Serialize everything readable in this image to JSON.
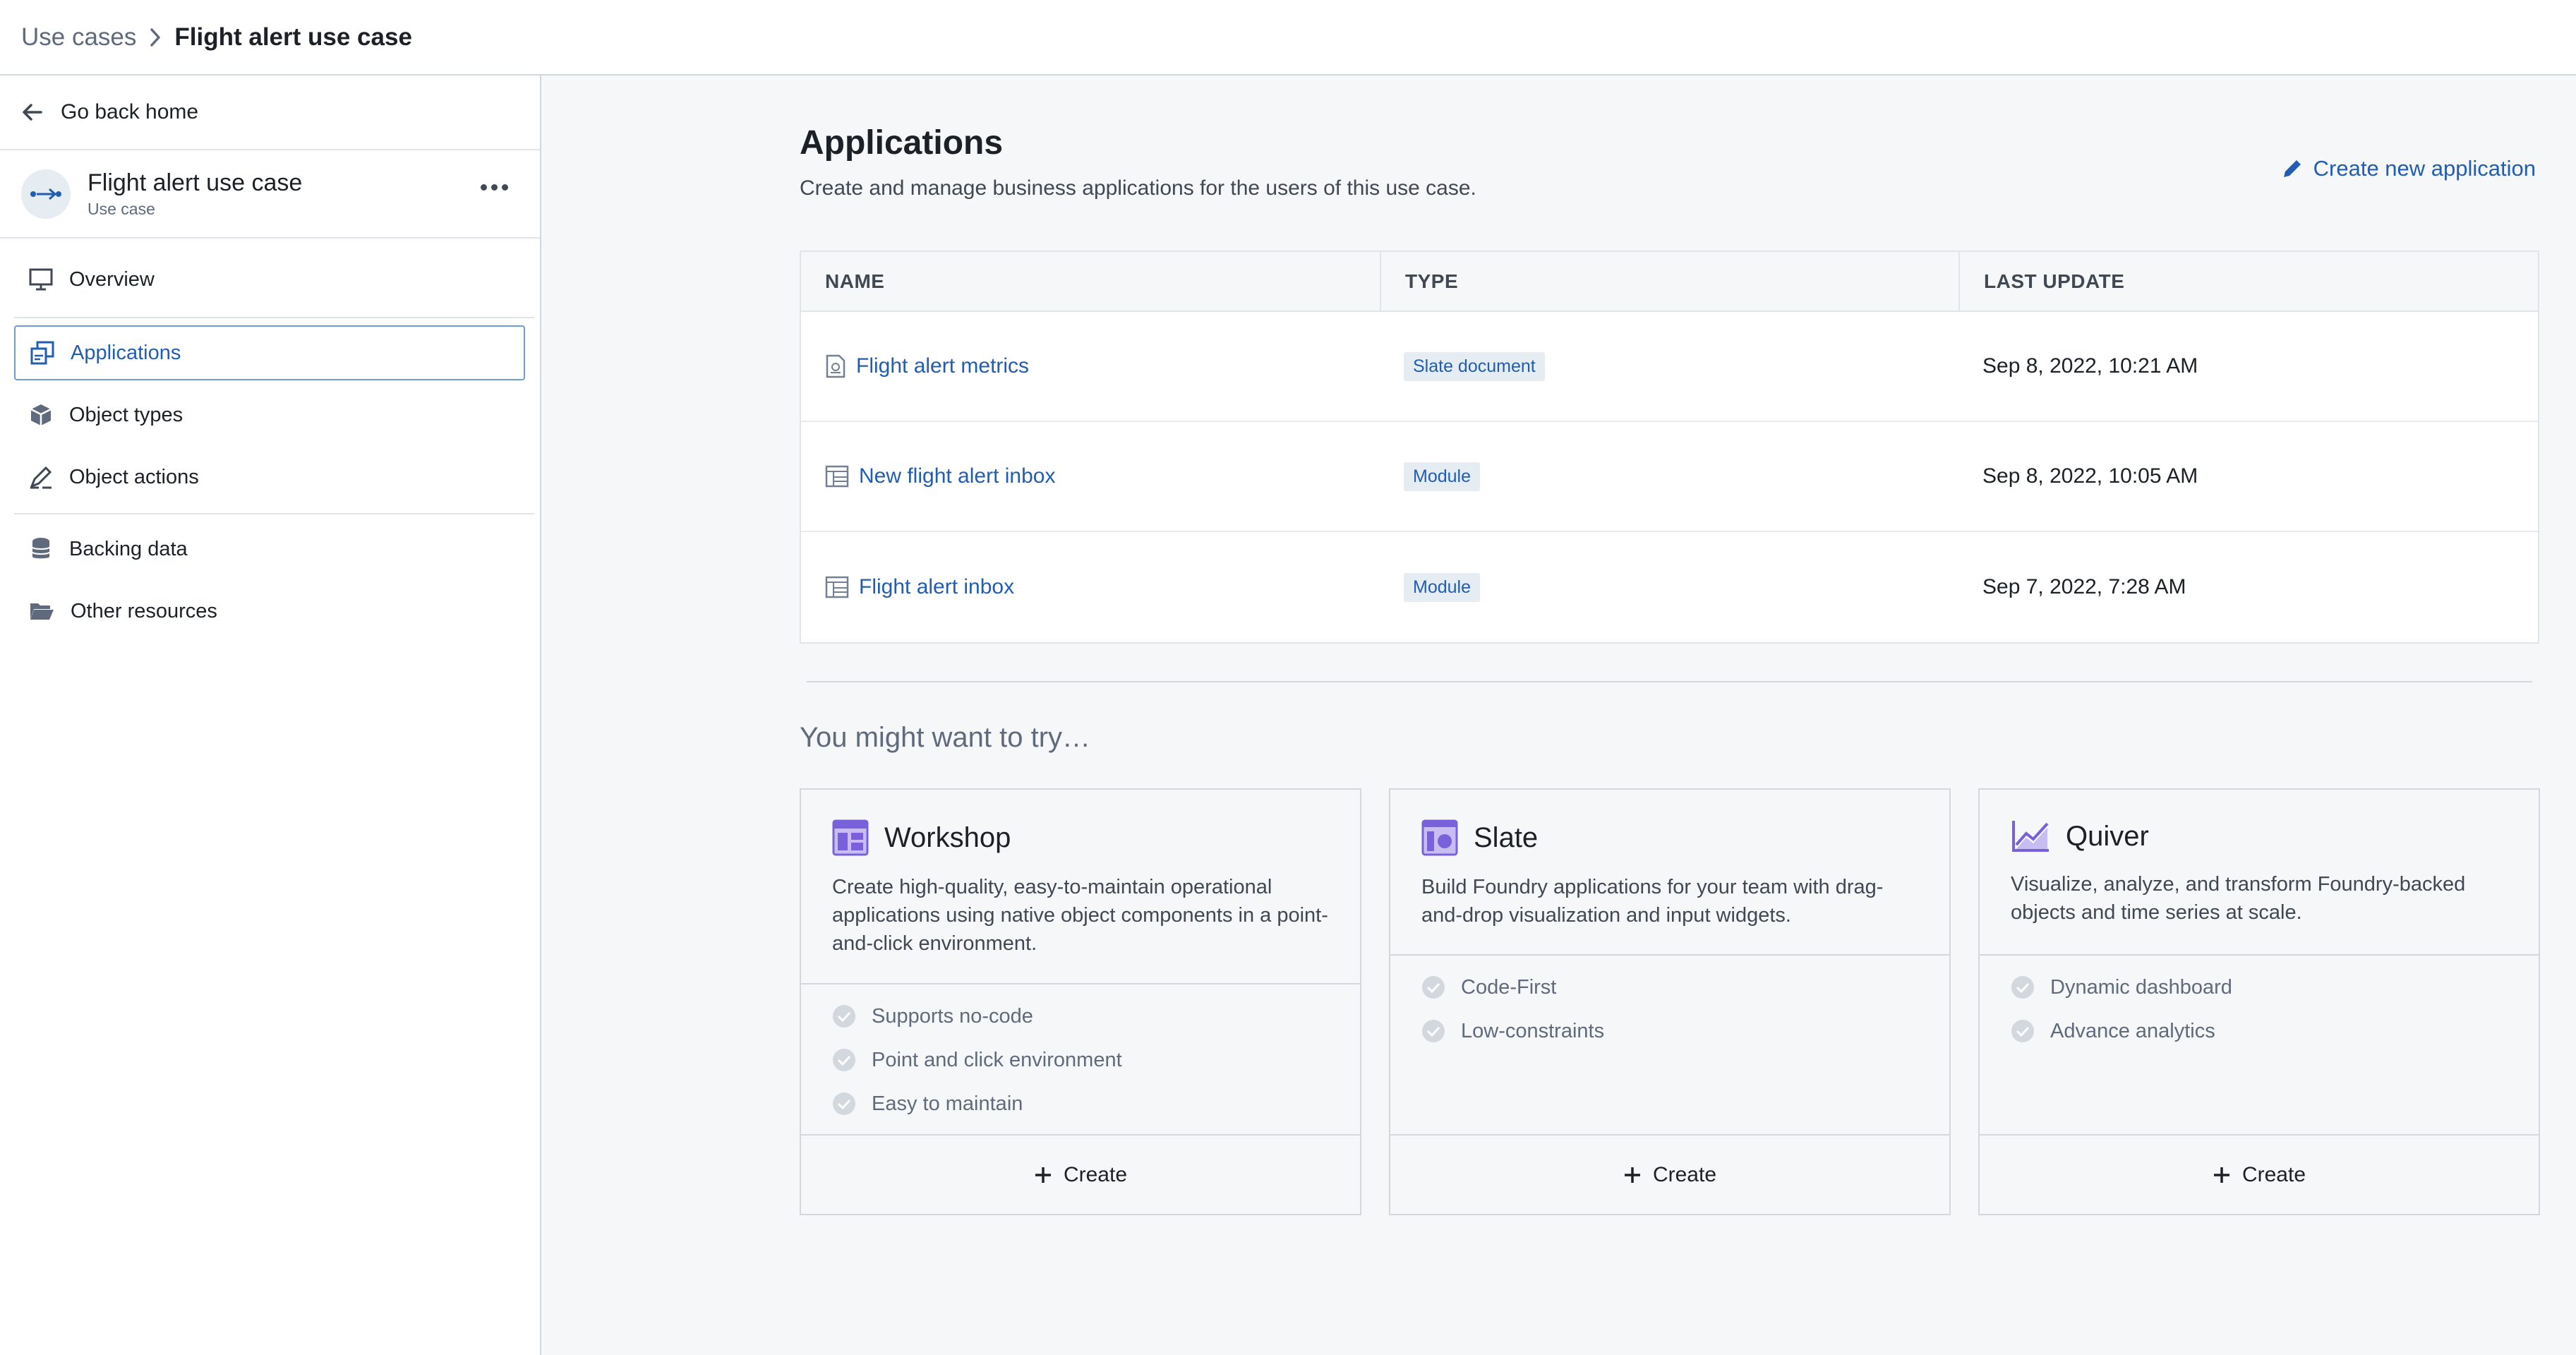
{
  "breadcrumb": {
    "root": "Use cases",
    "current": "Flight alert use case"
  },
  "sidebar": {
    "back_label": "Go back home",
    "use_case": {
      "title": "Flight alert use case",
      "subtitle": "Use case"
    },
    "items": [
      {
        "label": "Overview",
        "icon": "monitor-icon"
      },
      {
        "label": "Applications",
        "icon": "applications-icon",
        "active": true
      },
      {
        "label": "Object types",
        "icon": "cube-icon"
      },
      {
        "label": "Object actions",
        "icon": "edit-actions-icon"
      },
      {
        "label": "Backing data",
        "icon": "database-icon"
      },
      {
        "label": "Other resources",
        "icon": "folder-open-icon"
      }
    ]
  },
  "main": {
    "title": "Applications",
    "description": "Create and manage business applications for the users of this use case.",
    "create_new_label": "Create new application",
    "table": {
      "headers": [
        "NAME",
        "TYPE",
        "LAST UPDATE"
      ],
      "rows": [
        {
          "name": "Flight alert metrics",
          "type": "Slate document",
          "updated": "Sep 8, 2022, 10:21 AM"
        },
        {
          "name": "New flight alert inbox",
          "type": "Module",
          "updated": "Sep 8, 2022, 10:05 AM"
        },
        {
          "name": "Flight alert inbox",
          "type": "Module",
          "updated": "Sep 7, 2022, 7:28 AM"
        }
      ]
    },
    "try_title": "You might want to try…",
    "cards": [
      {
        "title": "Workshop",
        "description": "Create high-quality, easy-to-maintain operational applications using native object components in a point-and-click environment.",
        "features": [
          "Supports no-code",
          "Point and click environment",
          "Easy to maintain"
        ],
        "create_label": "Create"
      },
      {
        "title": "Slate",
        "description": "Build Foundry applications for your team with drag-and-drop visualization and input widgets.",
        "features": [
          "Code-First",
          "Low-constraints"
        ],
        "create_label": "Create"
      },
      {
        "title": "Quiver",
        "description": "Visualize, analyze, and transform Foundry-backed objects and time series at scale.",
        "features": [
          "Dynamic dashboard",
          "Advance analytics"
        ],
        "create_label": "Create"
      }
    ]
  },
  "colors": {
    "accent": "#215db0",
    "app_icon": "#7961db",
    "tag_bg": "#e5ecf2"
  }
}
